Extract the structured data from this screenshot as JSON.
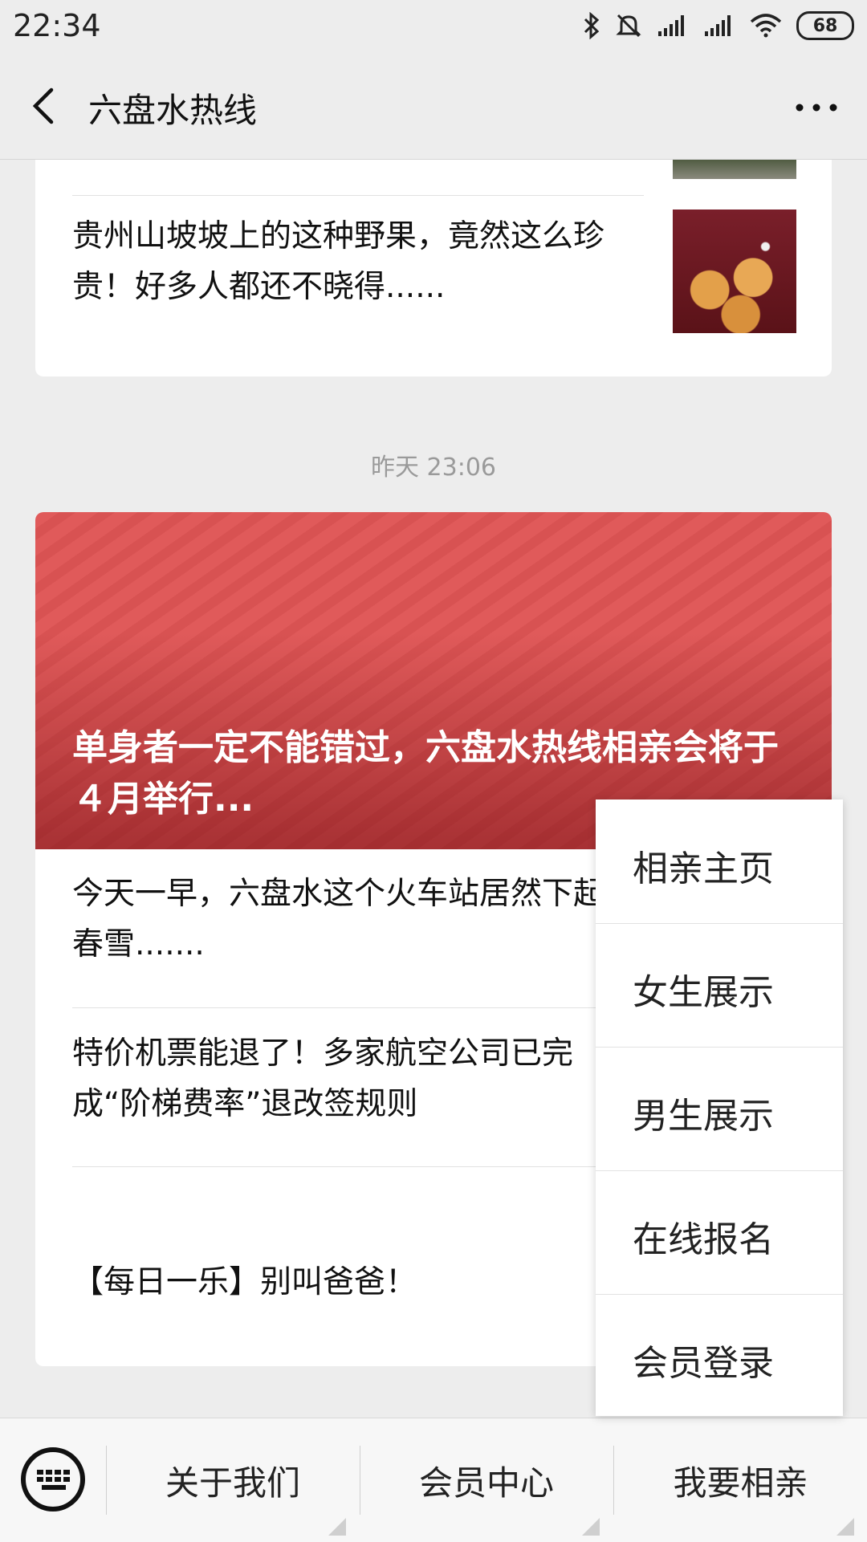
{
  "status_bar": {
    "time": "22:34",
    "battery": "68"
  },
  "nav": {
    "title": "六盘水热线"
  },
  "feed": {
    "items_top": [
      {
        "text": "贵州山坡坡上的这种野果，竟然这么珍贵！好多人都还不晓得......"
      }
    ],
    "timestamp": "昨天 23:06",
    "hero_title": "单身者一定不能错过，六盘水热线相亲会将于４月举行...",
    "items": [
      {
        "text": "今天一早，六盘水这个火车站居然下起了春雪......."
      },
      {
        "text": "特价机票能退了！多家航空公司已完成“阶梯费率”退改签规则"
      },
      {
        "text": "【每日一乐】别叫爸爸！"
      }
    ]
  },
  "menu": {
    "items": [
      {
        "label": "相亲主页"
      },
      {
        "label": "女生展示"
      },
      {
        "label": "男生展示"
      },
      {
        "label": "在线报名"
      },
      {
        "label": "会员登录"
      }
    ]
  },
  "bottom_bar": {
    "tabs": [
      {
        "label": "关于我们"
      },
      {
        "label": "会员中心"
      },
      {
        "label": "我要相亲"
      }
    ]
  },
  "icons": {
    "back": "chevron-left-icon",
    "more": "more-dots-icon",
    "keyboard": "keyboard-icon",
    "bluetooth": "bluetooth-icon",
    "mute": "bell-off-icon",
    "signal": "signal-icon",
    "wifi": "wifi-icon"
  },
  "colors": {
    "hero_red": "#e05a5a",
    "background": "#ededed"
  }
}
